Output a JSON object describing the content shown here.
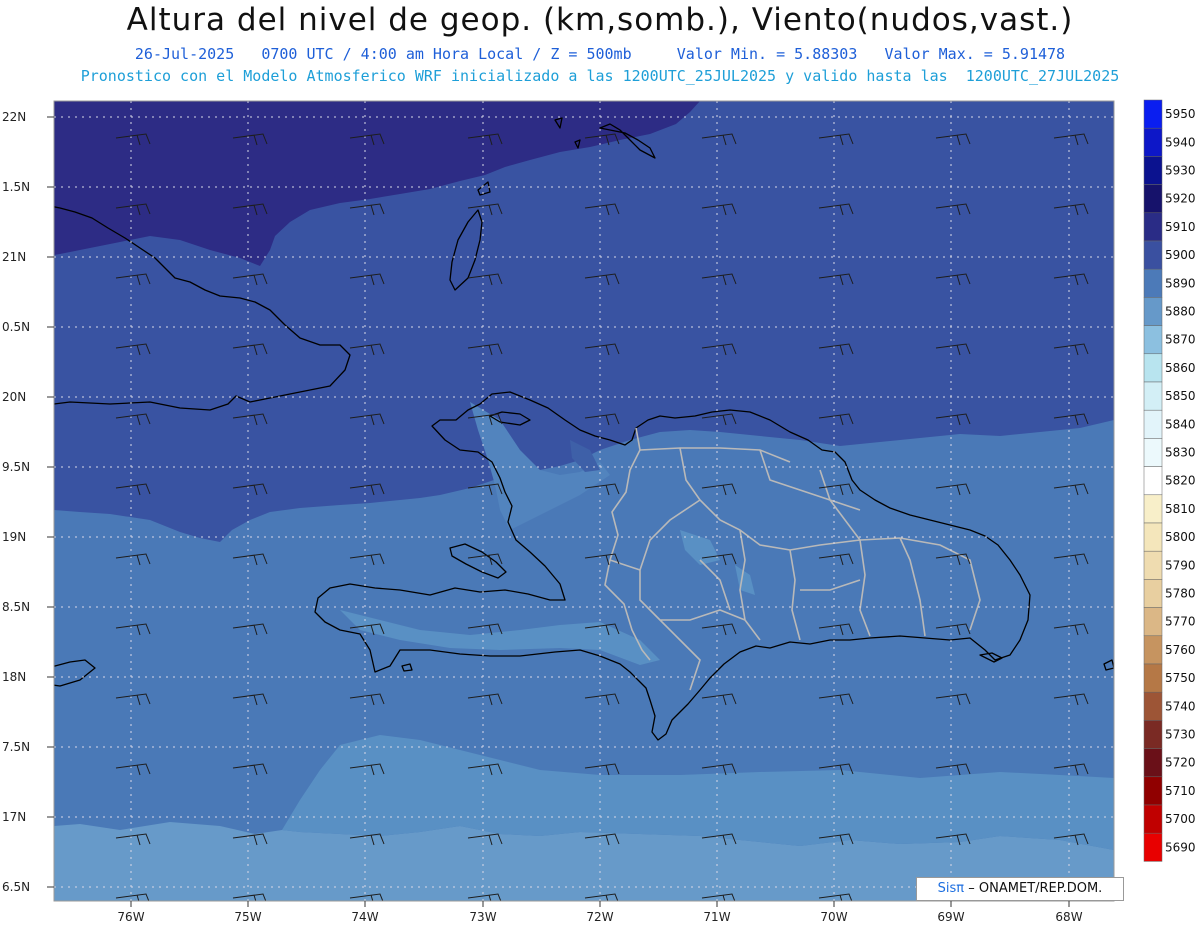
{
  "header": {
    "title": "Altura del nivel de geop. (km,somb.), Viento(nudos,vast.)",
    "subtitle1": "26-Jul-2025   0700 UTC / 4:00 am Hora Local / Z = 500mb     Valor Min. = 5.88303   Valor Max. = 5.91478",
    "subtitle2": "Pronostico con el Modelo Atmosferico WRF inicializado a las 1200UTC_25JUL2025 y valido hasta las  1200UTC_27JUL2025"
  },
  "axes": {
    "y_labels": [
      "22N",
      "1.5N",
      "21N",
      "0.5N",
      "20N",
      "9.5N",
      "19N",
      "8.5N",
      "18N",
      "7.5N",
      "17N",
      "6.5N"
    ],
    "x_labels": [
      "76W",
      "75W",
      "74W",
      "73W",
      "72W",
      "71W",
      "70W",
      "69W",
      "68W"
    ]
  },
  "colorbar": {
    "levels": [
      "5950",
      "5940",
      "5930",
      "5920",
      "5910",
      "5900",
      "5890",
      "5880",
      "5870",
      "5860",
      "5850",
      "5840",
      "5830",
      "5820",
      "5810",
      "5800",
      "5790",
      "5780",
      "5770",
      "5760",
      "5750",
      "5740",
      "5730",
      "5720",
      "5710",
      "5700",
      "5690"
    ],
    "colors": [
      "#0a1ef0",
      "#0d17c8",
      "#0b128f",
      "#16126b",
      "#2a2c86",
      "#3a50a0",
      "#4c7ab8",
      "#6699c9",
      "#8cc0e0",
      "#b8e4ef",
      "#d3eff6",
      "#e2f4fa",
      "#ecf9fc",
      "#ffffff",
      "#f8efc9",
      "#f4e6bb",
      "#efdcb0",
      "#e8cfa0",
      "#dbb786",
      "#c69460",
      "#b57846",
      "#9d5536",
      "#7a2a24",
      "#6a1018",
      "#900000",
      "#c00000",
      "#e80000"
    ]
  },
  "field_colors": {
    "z5910": "#2d2c85",
    "z5900": "#3953a2",
    "z5890": "#4a79b7",
    "z5880": "#679ac9",
    "z5870": "#86b6dc"
  },
  "credit": {
    "sis": "Sisπ",
    "org": "– ONAMET/REP.DOM."
  }
}
